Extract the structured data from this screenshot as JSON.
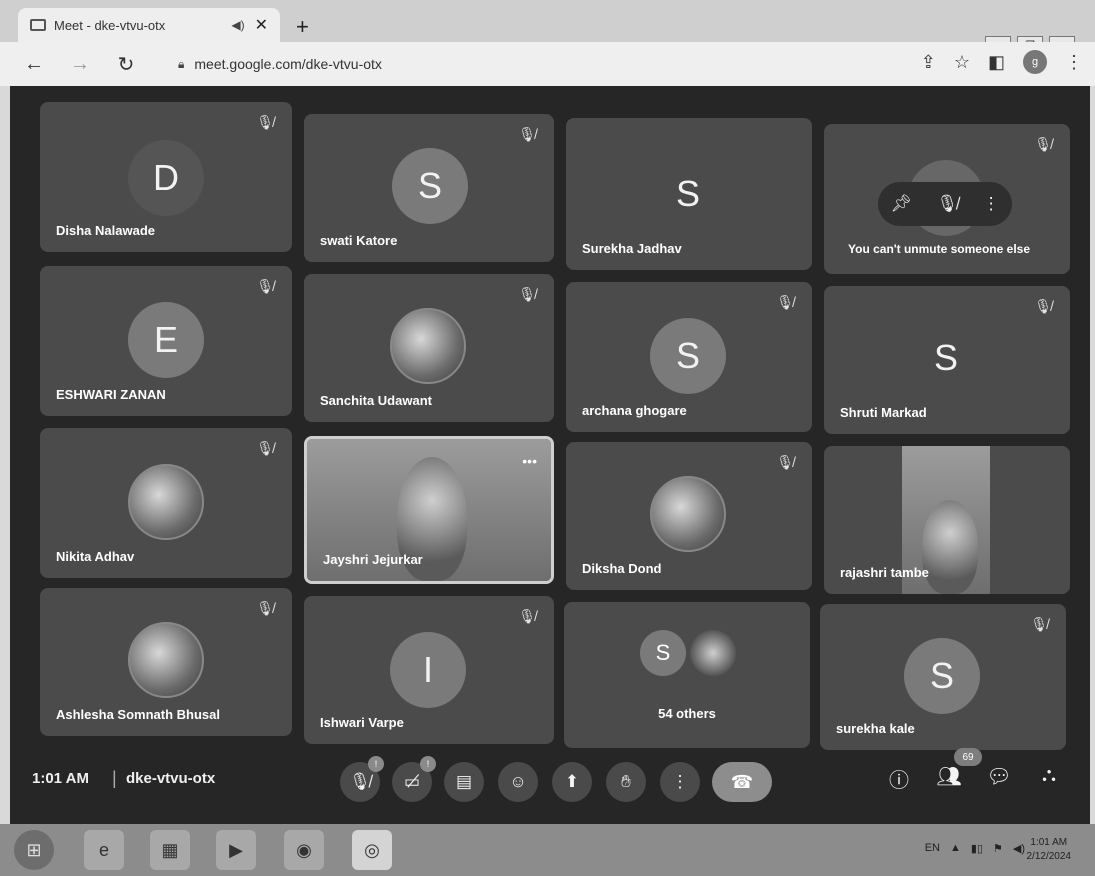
{
  "browser": {
    "tab_title": "Meet - dke-vtvu-otx",
    "new_tab": "+",
    "url": "meet.google.com/dke-vtvu-otx",
    "avatar_letter": "g"
  },
  "tiles": [
    {
      "name": "Disha Nalawade",
      "letter": "D",
      "type": "letter",
      "muted": true
    },
    {
      "name": "swati Katore",
      "letter": "S",
      "type": "letter",
      "muted": true
    },
    {
      "name": "Surekha Jadhav",
      "letter": "S",
      "type": "letter",
      "muted": false
    },
    {
      "name": "",
      "letter": "",
      "type": "hover",
      "muted": true,
      "tooltip": "You can't unmute someone else"
    },
    {
      "name": "ESHWARI ZANAN",
      "letter": "E",
      "type": "letter",
      "muted": true
    },
    {
      "name": "Sanchita Udawant",
      "letter": "",
      "type": "photo",
      "muted": true
    },
    {
      "name": "archana ghogare",
      "letter": "S",
      "type": "letter",
      "muted": true
    },
    {
      "name": "Shruti Markad",
      "letter": "S",
      "type": "letter",
      "muted": true
    },
    {
      "name": "Nikita Adhav",
      "letter": "",
      "type": "photo",
      "muted": true
    },
    {
      "name": "Jayshri Jejurkar",
      "letter": "",
      "type": "video",
      "muted": false
    },
    {
      "name": "Diksha Dond",
      "letter": "",
      "type": "photo",
      "muted": true
    },
    {
      "name": "rajashri tambe",
      "letter": "",
      "type": "video2",
      "muted": false
    },
    {
      "name": "Ashlesha Somnath Bhusal",
      "letter": "",
      "type": "photo",
      "muted": true
    },
    {
      "name": "Ishwari Varpe",
      "letter": "I",
      "type": "letter",
      "muted": true
    },
    {
      "name": "54 others",
      "letter": "S",
      "type": "others",
      "muted": false
    },
    {
      "name": "surekha kale",
      "letter": "S",
      "type": "letter",
      "muted": true
    }
  ],
  "bottom": {
    "time": "1:01 AM",
    "separator": "|",
    "meeting_code": "dke-vtvu-otx",
    "mic_badge": "!",
    "cam_badge": "!",
    "participant_count": "69"
  },
  "taskbar": {
    "clock_time": "1:01 AM",
    "clock_date": "2/12/2024",
    "lang": "EN"
  },
  "colors": {
    "tile": "#4b4b4b",
    "background": "#262626",
    "end_call": "#8d8d8d"
  }
}
